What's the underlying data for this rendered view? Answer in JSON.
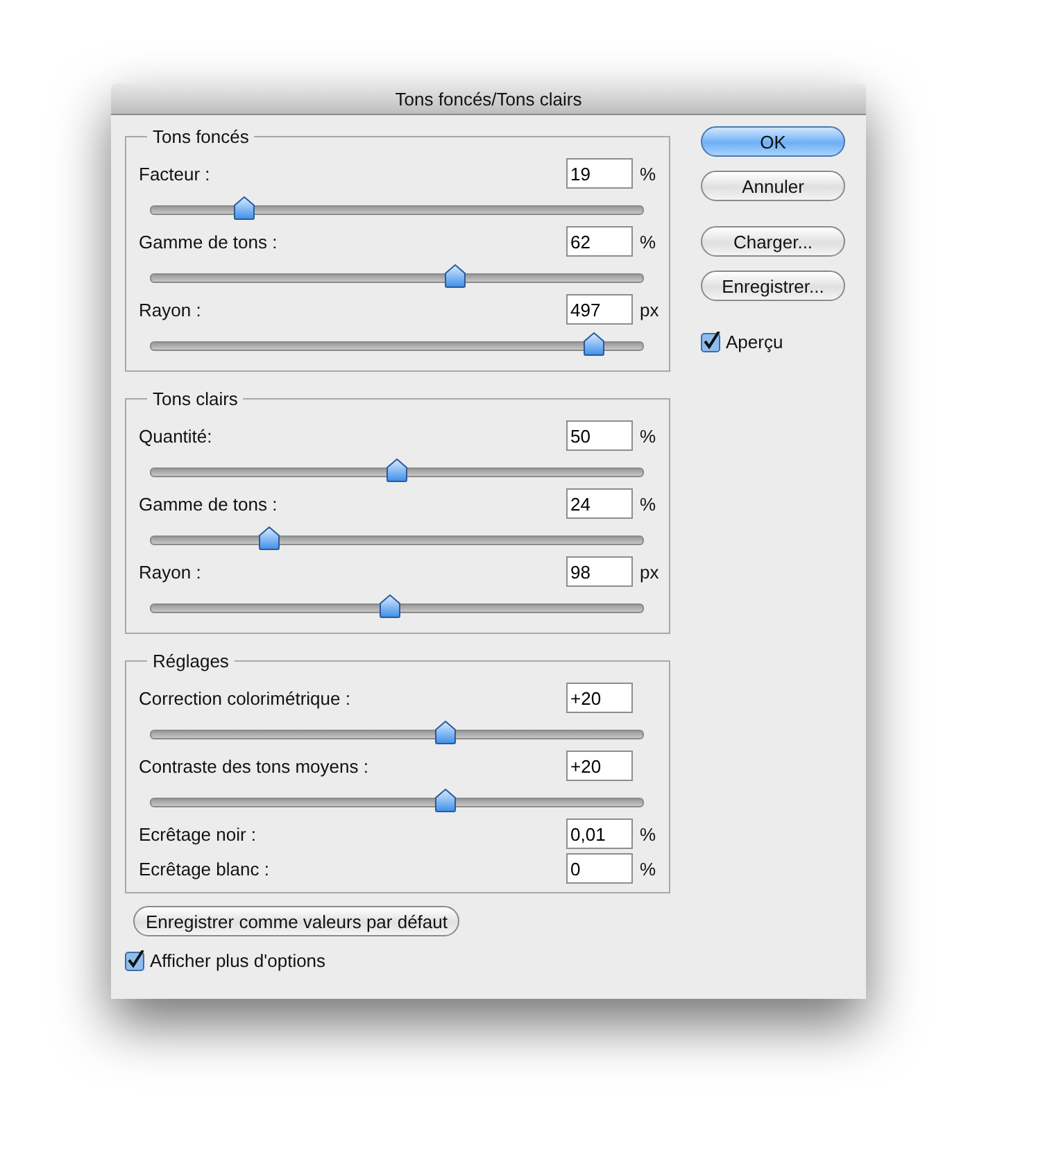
{
  "window": {
    "title": "Tons foncés/Tons clairs"
  },
  "sections": [
    {
      "title": "Tons foncés",
      "rows": [
        {
          "kind": "slider",
          "label": "Facteur :",
          "value": "19",
          "unit": "%",
          "level": 0.19
        },
        {
          "kind": "slider",
          "label": "Gamme de tons :",
          "value": "62",
          "unit": "%",
          "level": 0.62
        },
        {
          "kind": "slider",
          "label": "Rayon :",
          "value": "497",
          "unit": "px",
          "level": 0.9
        }
      ]
    },
    {
      "title": "Tons clairs",
      "rows": [
        {
          "kind": "slider",
          "label": "Quantité:",
          "value": "50",
          "unit": "%",
          "level": 0.5
        },
        {
          "kind": "slider",
          "label": "Gamme de tons :",
          "value": "24",
          "unit": "%",
          "level": 0.24
        },
        {
          "kind": "slider",
          "label": "Rayon :",
          "value": "98",
          "unit": "px",
          "level": 0.485
        }
      ]
    },
    {
      "title": "Réglages",
      "rows": [
        {
          "kind": "slider",
          "label": "Correction colorimétrique :",
          "value": "+20",
          "level": 0.6
        },
        {
          "kind": "slider",
          "label": "Contraste des tons moyens :",
          "value": "+20",
          "level": 0.6
        },
        {
          "kind": "field",
          "label": "Ecrêtage noir :",
          "value": "0,01",
          "unit": "%"
        },
        {
          "kind": "field",
          "label": "Ecrêtage blanc :",
          "value": "0",
          "unit": "%"
        }
      ]
    }
  ],
  "buttons": [
    {
      "label": "OK",
      "default": true
    },
    {
      "label": "Annuler",
      "default": false
    },
    {
      "label": "Charger...",
      "default": false
    },
    {
      "label": "Enregistrer...",
      "default": false
    }
  ],
  "preview": {
    "label": "Aperçu",
    "checked": true
  },
  "save_defaults_button": "Enregistrer comme valeurs par défaut",
  "more_options": {
    "label": "Afficher plus d'options",
    "checked": true
  }
}
